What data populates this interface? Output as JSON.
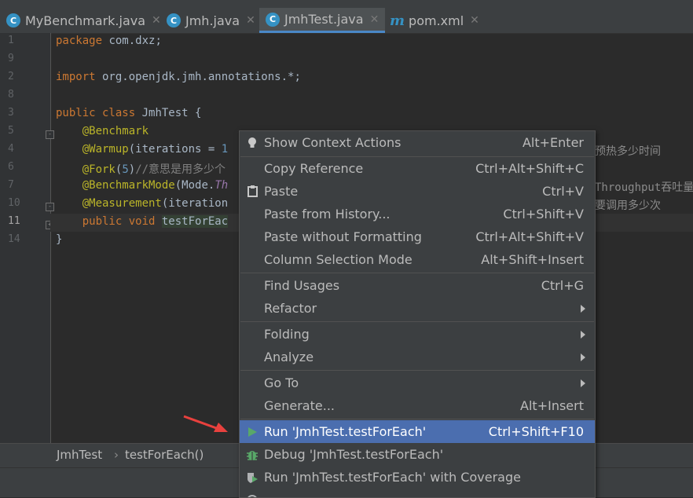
{
  "tabs": [
    {
      "label": "MyBenchmark.java",
      "icon": "C"
    },
    {
      "label": "Jmh.java",
      "icon": "C"
    },
    {
      "label": "JmhTest.java",
      "icon": "C",
      "active": true
    },
    {
      "label": "pom.xml",
      "icon": "m"
    }
  ],
  "gutter": {
    "lines": [
      "1",
      "2",
      "3",
      "4",
      "5",
      "6",
      "7",
      "8",
      "9",
      "10",
      "11",
      "14"
    ]
  },
  "code": {
    "l1": {
      "kw": "package",
      "rest": " com.dxz;"
    },
    "l3": {
      "kw": "import",
      "rest": " org.openjdk.jmh.annotations.*;"
    },
    "l5": {
      "kw": "public class",
      "rest": " JmhTest {"
    },
    "l6": {
      "ann": "@Benchmark"
    },
    "l7": {
      "ann": "@Warmup",
      "rest": "(iterations = ",
      "num": "1",
      "tail": "预热多少时间"
    },
    "l8": {
      "ann": "@Fork",
      "open": "(",
      "num": "5",
      "close": ")",
      "cmt": "//意思是用多少个"
    },
    "l9": {
      "ann": "@BenchmarkMode",
      "rest": "(Mode.",
      "ital": "Th",
      "tail": "Throughput吞吐量"
    },
    "l10": {
      "ann": "@Measurement",
      "rest": "(iteration",
      "tail": "要调用多少次"
    },
    "l11": {
      "kw": "public void",
      "method": "testForEac"
    },
    "l14": {
      "rest": "}"
    }
  },
  "breadcrumb": {
    "class_name": "JmhTest",
    "method_name": "testForEach()",
    "separator": "›"
  },
  "context_menu": {
    "show_context_actions": {
      "label": "Show Context Actions",
      "shortcut": "Alt+Enter",
      "icon": "lightbulb-icon"
    },
    "copy_reference": {
      "label": "Copy Reference",
      "shortcut": "Ctrl+Alt+Shift+C"
    },
    "paste": {
      "label": "Paste",
      "shortcut": "Ctrl+V",
      "icon": "clipboard-icon"
    },
    "paste_from_history": {
      "label": "Paste from History...",
      "shortcut": "Ctrl+Shift+V"
    },
    "paste_without_formatting": {
      "label": "Paste without Formatting",
      "shortcut": "Ctrl+Alt+Shift+V"
    },
    "column_selection_mode": {
      "label": "Column Selection Mode",
      "shortcut": "Alt+Shift+Insert"
    },
    "find_usages": {
      "label": "Find Usages",
      "shortcut": "Ctrl+G"
    },
    "refactor": {
      "label": "Refactor"
    },
    "folding": {
      "label": "Folding"
    },
    "analyze": {
      "label": "Analyze"
    },
    "go_to": {
      "label": "Go To"
    },
    "generate": {
      "label": "Generate...",
      "shortcut": "Alt+Insert"
    },
    "run": {
      "label": "Run 'JmhTest.testForEach'",
      "shortcut": "Ctrl+Shift+F10",
      "icon": "run-icon"
    },
    "debug": {
      "label": "Debug 'JmhTest.testForEach'",
      "icon": "debug-icon"
    },
    "run_coverage": {
      "label": "Run 'JmhTest.testForEach' with Coverage",
      "icon": "coverage-icon"
    }
  },
  "colors": {
    "selection": "#4b6eaf",
    "annotation": "#bbb529",
    "keyword": "#cc7832",
    "pointer_arrow": "#e8413e"
  }
}
